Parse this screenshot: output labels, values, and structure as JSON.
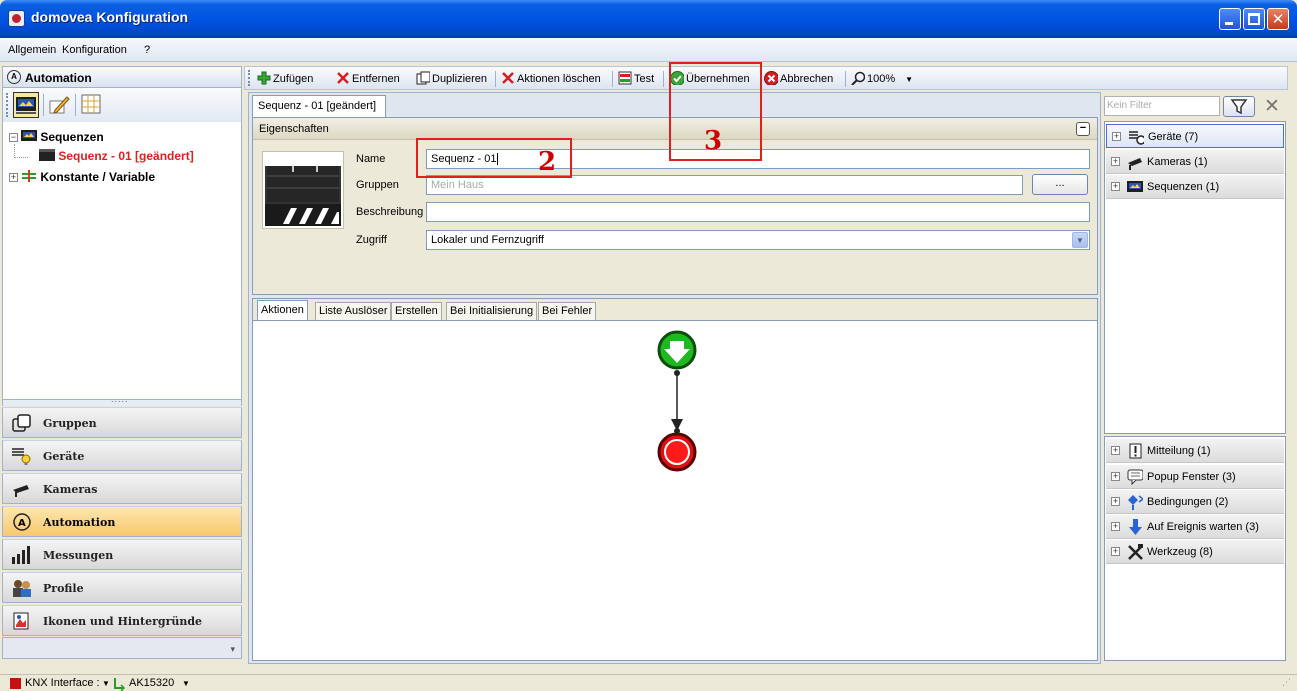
{
  "window": {
    "title": "domovea Konfiguration"
  },
  "menu": {
    "items": [
      "Allgemein",
      "Konfiguration",
      "?"
    ]
  },
  "left": {
    "header": "Automation",
    "tree": {
      "sequences_label": "Sequenzen",
      "sequence_item": "Sequenz - 01  [geändert]",
      "constants_label": "Konstante / Variable"
    },
    "nav": [
      "Gruppen",
      "Geräte",
      "Kameras",
      "Automation",
      "Messungen",
      "Profile",
      "Ikonen und Hintergründe"
    ]
  },
  "toolbar": {
    "add": "Zufügen",
    "remove": "Entfernen",
    "duplicate": "Duplizieren",
    "delete_actions": "Aktionen löschen",
    "test": "Test",
    "apply": "Übernehmen",
    "cancel": "Abbrechen",
    "zoom": "100%"
  },
  "document": {
    "tab": "Sequenz - 01  [geändert]",
    "properties_title": "Eigenschaften",
    "name_label": "Name",
    "name_value": "Sequenz - 01",
    "groups_label": "Gruppen",
    "groups_value": "Mein Haus",
    "groups_button": "...",
    "description_label": "Beschreibung",
    "description_value": "",
    "access_label": "Zugriff",
    "access_value": "Lokaler und Fernzugriff",
    "action_tabs": [
      "Aktionen",
      "Liste Auslöser",
      "Erstellen",
      "Bei Initialisierung",
      "Bei Fehler"
    ]
  },
  "annotations": {
    "name_marker": "2",
    "apply_marker": "3"
  },
  "right": {
    "filter_placeholder": "Kein Filter",
    "top_items": [
      "Geräte (7)",
      "Kameras (1)",
      "Sequenzen (1)"
    ],
    "bottom_items": [
      "Mitteilung (1)",
      "Popup Fenster (3)",
      "Bedingungen (2)",
      "Auf Ereignis warten (3)",
      "Werkzeug (8)"
    ]
  },
  "status": {
    "interface": "KNX Interface :",
    "device": "AK15320"
  },
  "colors": {
    "title_bar": "#0054e3",
    "active_nav": "#f9c76c",
    "annotation": "#e02020",
    "start_node": "#1fb81f",
    "end_node": "#e01010"
  }
}
